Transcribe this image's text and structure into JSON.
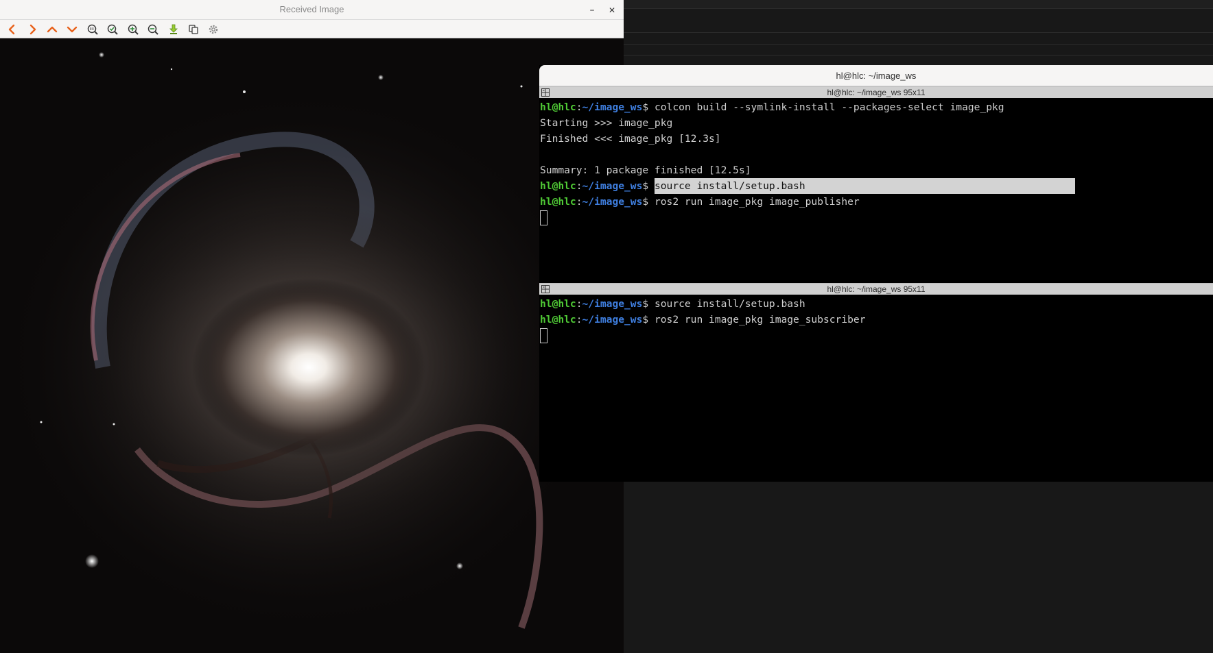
{
  "viewer": {
    "title": "Received Image",
    "minimize_glyph": "–",
    "close_glyph": "✕",
    "toolbar": [
      {
        "name": "prev-icon",
        "color": "#e8621c"
      },
      {
        "name": "next-icon",
        "color": "#e8621c"
      },
      {
        "name": "up-icon",
        "color": "#e8621c"
      },
      {
        "name": "down-icon",
        "color": "#e8621c"
      },
      {
        "name": "zoom-original-icon",
        "color": "#3a3a3a"
      },
      {
        "name": "zoom-fit-icon",
        "color": "#2e8b3a"
      },
      {
        "name": "zoom-in-icon",
        "color": "#2e8b3a"
      },
      {
        "name": "zoom-out-icon",
        "color": "#2e8b3a"
      },
      {
        "name": "save-icon",
        "color": "#7ab02c"
      },
      {
        "name": "copy-icon",
        "color": "#3a3a3a"
      },
      {
        "name": "settings-icon",
        "color": "#8a8a8a"
      }
    ]
  },
  "terminal": {
    "window_title": "hl@hlc: ~/image_ws",
    "pane1": {
      "title": "hl@hlc: ~/image_ws 95x11",
      "lines": [
        {
          "user": "hl@hlc",
          "path": "~/image_ws",
          "cmd": "colcon build --symlink-install --packages-select image_pkg"
        },
        {
          "text": "Starting >>> image_pkg"
        },
        {
          "text": "Finished <<< image_pkg [12.3s]"
        },
        {
          "text": ""
        },
        {
          "text": "Summary: 1 package finished [12.5s]"
        },
        {
          "user": "hl@hlc",
          "path": "~/image_ws",
          "cmd": "source install/setup.bash",
          "highlight": true
        },
        {
          "user": "hl@hlc",
          "path": "~/image_ws",
          "cmd": "ros2 run image_pkg image_publisher"
        }
      ]
    },
    "pane2": {
      "title": "hl@hlc: ~/image_ws 95x11",
      "lines": [
        {
          "user": "hl@hlc",
          "path": "~/image_ws",
          "cmd": "source install/setup.bash"
        },
        {
          "user": "hl@hlc",
          "path": "~/image_ws",
          "cmd": "ros2 run image_pkg image_subscriber"
        }
      ]
    }
  },
  "colors": {
    "prompt_user": "#4fc935",
    "prompt_path": "#3f7fe0",
    "terminal_bg": "#000000",
    "terminal_fg": "#d0d0d0"
  }
}
